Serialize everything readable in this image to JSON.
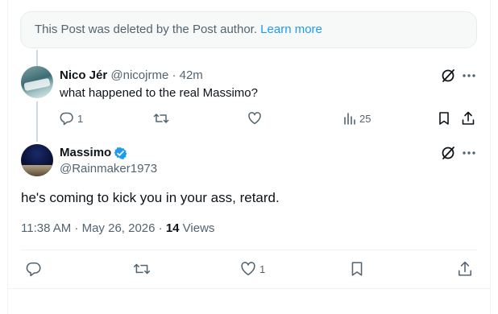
{
  "notice": {
    "text": "This Post was deleted by the Post author. ",
    "link": "Learn more"
  },
  "reply": {
    "name": "Nico Jér",
    "handle_time": " @nicojrme · 42m",
    "text": "what happened to the real Massimo?",
    "reply_count": "1",
    "views": "25"
  },
  "post": {
    "name": "Massimo",
    "handle": "@Rainmaker1973",
    "text": "he's coming to kick you in your ass, retard.",
    "timestamp": "11:38 AM · May 26, 2026 · ",
    "views_count": "14",
    "views_label": " Views",
    "like_count": "1"
  },
  "colors": {
    "accent": "#1d9bf0",
    "muted": "#536471",
    "text": "#0f1419"
  },
  "icons": [
    "grok-icon",
    "more-icon",
    "reply-icon",
    "retweet-icon",
    "like-icon",
    "views-icon",
    "bookmark-icon",
    "share-icon",
    "verified-badge-icon"
  ]
}
